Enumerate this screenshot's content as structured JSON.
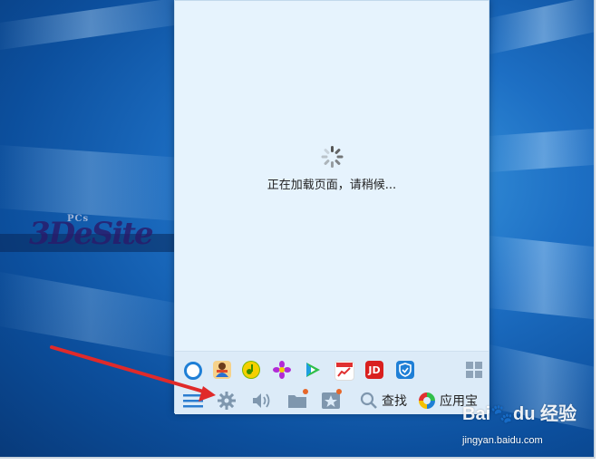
{
  "panel": {
    "loading_text": "正在加载页面，请稍候..."
  },
  "app_bar": {
    "items": [
      {
        "name": "browser-icon",
        "color": "#1f7fd6"
      },
      {
        "name": "game-icon",
        "color": "#f0a030"
      },
      {
        "name": "music-icon",
        "color": "#7ab800"
      },
      {
        "name": "flower-icon",
        "color": "#b22bd6"
      },
      {
        "name": "video-play-icon",
        "color": "#2fbf4a"
      },
      {
        "name": "stock-chart-icon",
        "color": "#e03030"
      },
      {
        "name": "jd-icon",
        "label": "JD",
        "color": "#d9201f"
      },
      {
        "name": "shield-icon",
        "color": "#1f7fd6"
      }
    ]
  },
  "toolbar": {
    "search_label": "查找",
    "appstore_label": "应用宝"
  },
  "watermark": {
    "site": "jingyan.baidu.com",
    "brand_a": "Bai",
    "brand_b": "du",
    "brand_c": "经验"
  },
  "colors": {
    "panel_bg": "#e6f3fd",
    "toolbar_bg": "#dcebf8",
    "arrow": "#e02a2a",
    "badge": "#e6672a"
  }
}
